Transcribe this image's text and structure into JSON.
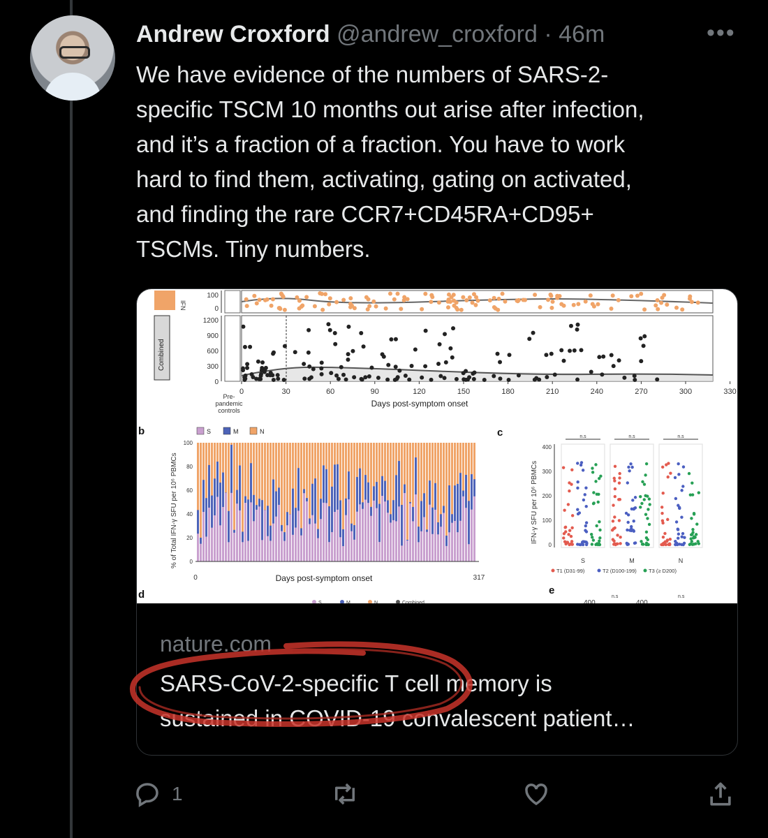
{
  "tweet": {
    "author_name": "Andrew Croxford",
    "handle": "@andrew_croxford",
    "separator": "·",
    "time": "46m",
    "more_label": "•••",
    "text": "We have evidence of the numbers of SARS-2-\nspecific TSCM 10 months out arise after infection,\nand it’s a fraction of a fraction. You have to work\nhard to find them, activating, gating on activated,\nand finding the rare CCR7+CD45RA+CD95+\nTSCMs. Tiny numbers."
  },
  "card": {
    "domain": "nature.com",
    "title": "SARS-CoV-2-specific T cell memory is\nsustained in COVID-19 convalescent patient…",
    "figure": {
      "panel_a": {
        "facet_label": "Combined",
        "y_ticks_top": [
          "100",
          "0"
        ],
        "y_ticks": [
          "1200",
          "900",
          "600",
          "300",
          "0"
        ],
        "x_ticks": [
          "0",
          "30",
          "60",
          "90",
          "120",
          "150",
          "180",
          "210",
          "240",
          "270",
          "300",
          "330"
        ],
        "x_label": "Days post-symptom onset",
        "control_label": "Pre-\npandemic\ncontrols",
        "truncated_y_label": "IFN"
      },
      "panel_b": {
        "letter": "b",
        "legend": [
          "S",
          "M",
          "N"
        ],
        "y_label": "% of Total IFN-γ SFU per 10⁶ PBMCs",
        "y_ticks": [
          "100",
          "80",
          "60",
          "40",
          "20",
          "0"
        ],
        "x_start": "0",
        "x_end": "317",
        "x_label": "Days post-symptom onset"
      },
      "panel_c": {
        "letter": "c",
        "y_label": "IFN-γ SFU per 10⁶ PBMCs",
        "y_ticks": [
          "400",
          "300",
          "200",
          "100",
          "0"
        ],
        "groups": [
          "S",
          "M",
          "N"
        ],
        "sig_label": "n.s",
        "legend": [
          "T1 (D31-99)",
          "T2 (D100-199)",
          "T3 (≥ D200)"
        ]
      },
      "panel_d": {
        "letter": "d",
        "legend": [
          "S",
          "M",
          "N",
          "Combined"
        ]
      },
      "panel_e": {
        "letter": "e",
        "tick": "400",
        "sig_label": "n.s"
      },
      "colors": {
        "S": "#c9a0cf",
        "M": "#4d63b8",
        "N": "#f0a468",
        "T1": "#e35b4f",
        "T2": "#4b5fc1",
        "T3": "#27a055"
      }
    }
  },
  "actions": {
    "reply_count": "1",
    "icons": [
      "reply-icon",
      "retweet-icon",
      "like-icon",
      "share-icon"
    ]
  },
  "colors": {
    "background": "#000000",
    "text": "#e7e9ea",
    "secondary": "#71767b",
    "border": "#2f3336",
    "annotation": "#c8342a"
  }
}
